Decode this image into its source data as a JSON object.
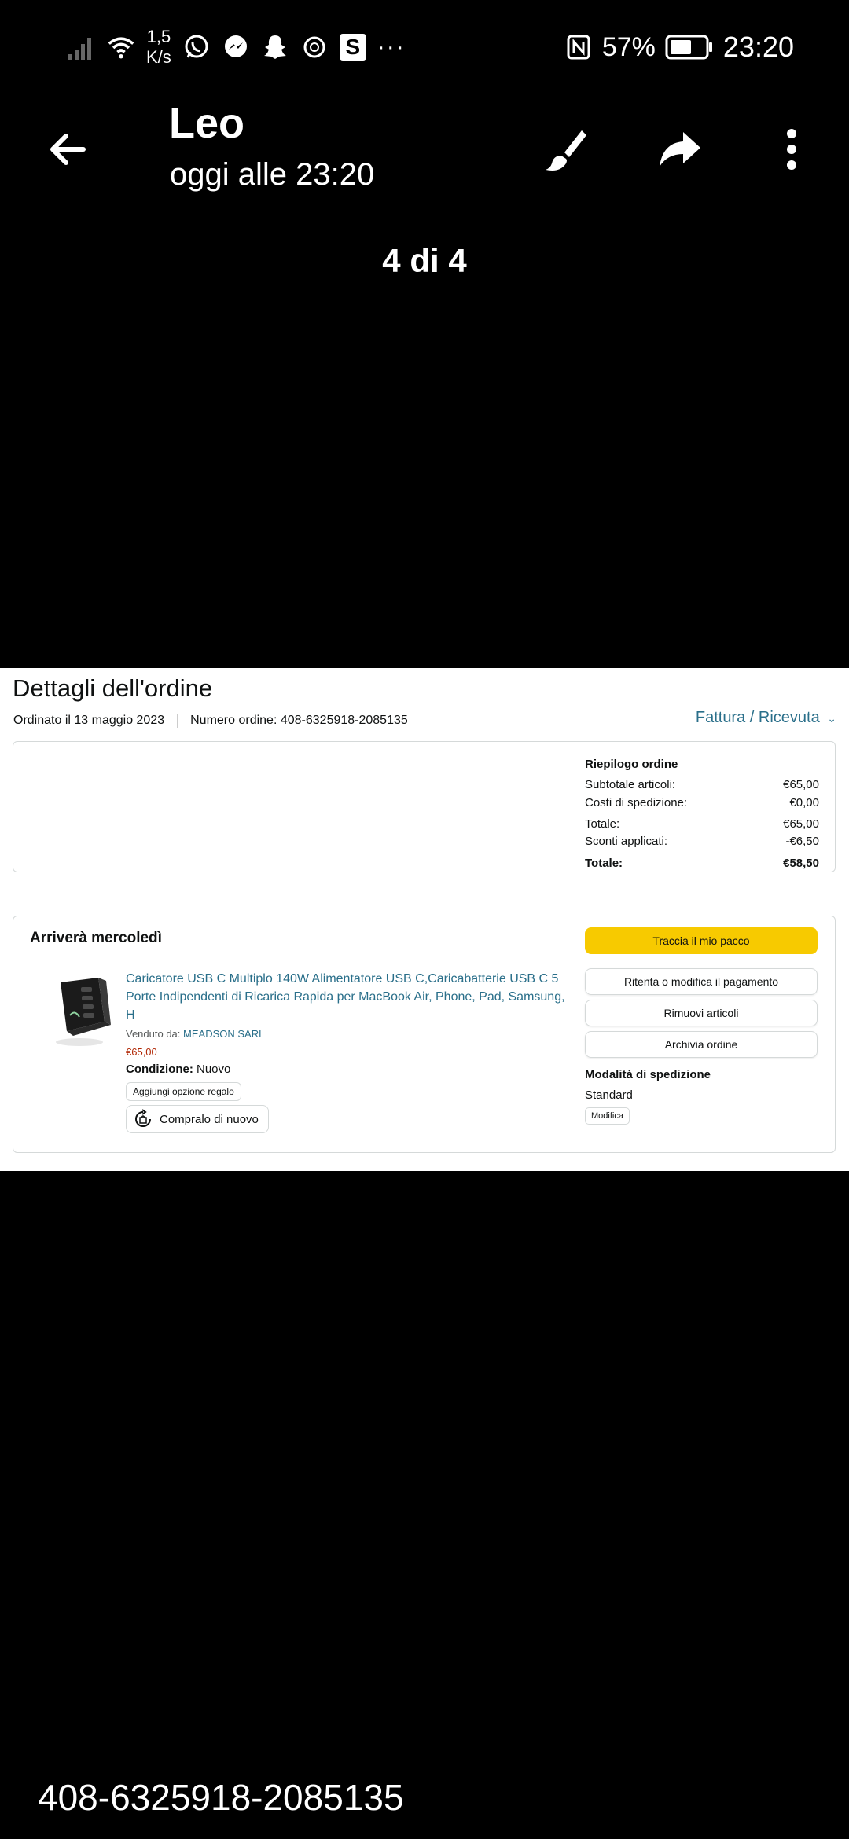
{
  "status_bar": {
    "net_speed_value": "1,5",
    "net_speed_unit": "K/s",
    "battery": "57%",
    "clock": "23:20",
    "icons": [
      "signal-icon",
      "wifi-icon",
      "whatsapp-icon",
      "messenger-icon",
      "snapchat-icon",
      "chatgpt-icon",
      "s-app-icon",
      "more-notifications-icon",
      "nfc-icon",
      "battery-icon"
    ],
    "s_app_letter": "S"
  },
  "app_bar": {
    "sender": "Leo",
    "timestamp": "oggi alle 23:20",
    "counter": "4 di 4"
  },
  "order_page": {
    "title": "Dettagli dell'ordine",
    "ordered_on": "Ordinato il 13 maggio 2023",
    "order_number": "Numero ordine: 408-6325918-2085135",
    "invoice_link": "Fattura / Ricevuta",
    "summary": {
      "heading": "Riepilogo ordine",
      "rows": [
        {
          "label": "Subtotale articoli:",
          "value": "€65,00"
        },
        {
          "label": "Costi di spedizione:",
          "value": "€0,00"
        },
        {
          "label": "Totale:",
          "value": "€65,00"
        },
        {
          "label": "Sconti applicati:",
          "value": "-€6,50"
        },
        {
          "label": "Totale:",
          "value": "€58,50"
        }
      ]
    },
    "shipment": {
      "arrival": "Arriverà mercoledì",
      "product_title": "Caricatore USB C Multiplo 140W Alimentatore USB C,Caricabatterie USB C 5 Porte Indipendenti di Ricarica Rapida per MacBook Air, Phone, Pad, Samsung, H",
      "seller_prefix": "Venduto da:",
      "seller_name": "MEADSON SARL",
      "price": "€65,00",
      "condition_label": "Condizione:",
      "condition_value": "Nuovo",
      "gift_button": "Aggiungi opzione regalo",
      "buy_again_button": "Compralo di nuovo",
      "track_button": "Traccia il mio pacco",
      "retry_payment_button": "Ritenta o modifica il pagamento",
      "remove_items_button": "Rimuovi articoli",
      "archive_button": "Archivia ordine",
      "shipping_mode_heading": "Modalità di spedizione",
      "shipping_mode_value": "Standard",
      "edit_button": "Modifica"
    },
    "colors": {
      "link": "#2a6f8a",
      "price": "#b12704",
      "track_button": "#f7ca00",
      "border": "#d5d9d9"
    }
  },
  "caption": "408-6325918-2085135"
}
